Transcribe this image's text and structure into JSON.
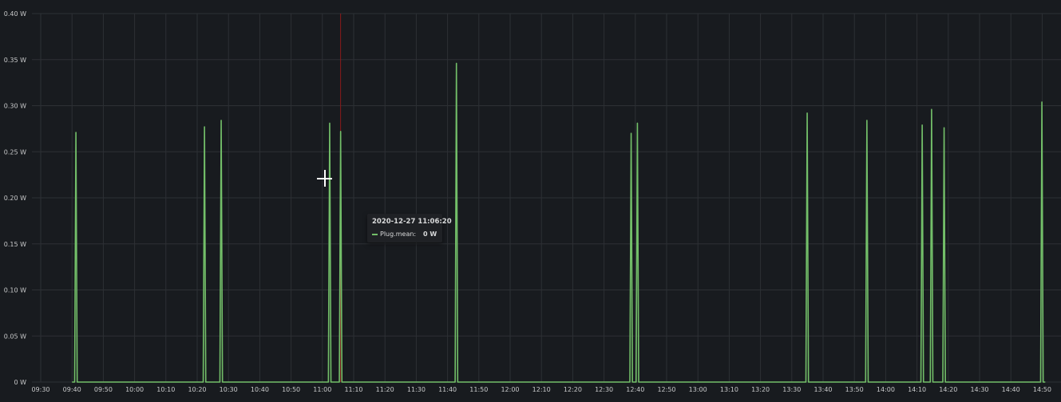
{
  "chart_data": {
    "type": "line",
    "title": "",
    "xlabel": "",
    "ylabel": "",
    "ylim": [
      0,
      0.4
    ],
    "y_ticks": [
      "0 W",
      "0.05 W",
      "0.10 W",
      "0.15 W",
      "0.20 W",
      "0.25 W",
      "0.30 W",
      "0.35 W",
      "0.40 W"
    ],
    "x_ticks": [
      "09:30",
      "09:40",
      "09:50",
      "10:00",
      "10:10",
      "10:20",
      "10:30",
      "10:40",
      "10:50",
      "11:00",
      "11:10",
      "11:20",
      "11:30",
      "11:40",
      "11:50",
      "12:00",
      "12:10",
      "12:20",
      "12:30",
      "12:40",
      "12:50",
      "13:00",
      "13:10",
      "13:20",
      "13:30",
      "13:40",
      "13:50",
      "14:00",
      "14:10",
      "14:20",
      "14:30",
      "14:40",
      "14:50"
    ],
    "grid": true,
    "series": [
      {
        "name": "Plug.mean",
        "color": "#73bf69",
        "unit": "W",
        "spikes": [
          {
            "x": "09:41:15",
            "y": 0.271
          },
          {
            "x": "10:22:20",
            "y": 0.277
          },
          {
            "x": "10:27:40",
            "y": 0.284
          },
          {
            "x": "11:02:20",
            "y": 0.281
          },
          {
            "x": "11:05:50",
            "y": 0.272
          },
          {
            "x": "11:42:50",
            "y": 0.346
          },
          {
            "x": "12:38:40",
            "y": 0.27
          },
          {
            "x": "12:40:40",
            "y": 0.281
          },
          {
            "x": "13:34:55",
            "y": 0.292
          },
          {
            "x": "13:54:00",
            "y": 0.284
          },
          {
            "x": "14:11:40",
            "y": 0.279
          },
          {
            "x": "14:14:40",
            "y": 0.296
          },
          {
            "x": "14:18:40",
            "y": 0.276
          },
          {
            "x": "14:49:55",
            "y": 0.304
          }
        ],
        "baseline": 0
      }
    ],
    "tooltip": {
      "time": "2020-12-27 11:06:20",
      "series_label": "Plug.mean:",
      "value": "0 W"
    },
    "marker_line_color": "#8b1a1a"
  }
}
